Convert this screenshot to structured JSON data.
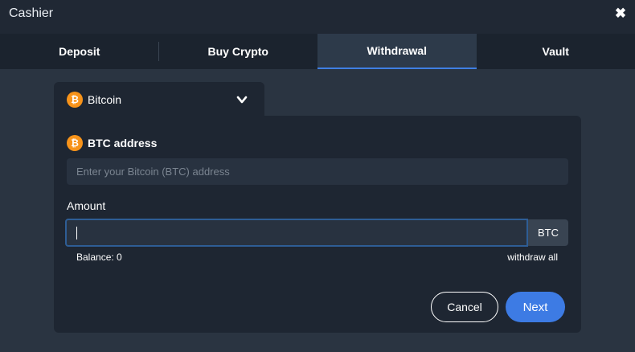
{
  "window": {
    "title": "Cashier",
    "close_icon": "close-icon"
  },
  "tabs": [
    {
      "label": "Deposit",
      "active": false
    },
    {
      "label": "Buy Crypto",
      "active": false
    },
    {
      "label": "Withdrawal",
      "active": true
    },
    {
      "label": "Vault",
      "active": false
    }
  ],
  "currency_select": {
    "selected": "Bitcoin",
    "icon": "bitcoin-icon",
    "icon_glyph": "₿",
    "chevron": "chevron-down-icon"
  },
  "address": {
    "label": "BTC address",
    "placeholder": "Enter your Bitcoin (BTC) address",
    "value": ""
  },
  "amount": {
    "label": "Amount",
    "value": "",
    "unit": "BTC",
    "balance": "Balance: 0",
    "withdraw_all": "withdraw all"
  },
  "actions": {
    "cancel": "Cancel",
    "next": "Next"
  },
  "colors": {
    "accent": "#3d7be4",
    "bitcoin": "#f7931a",
    "background": "#2a3441",
    "panel": "#1e2632"
  }
}
